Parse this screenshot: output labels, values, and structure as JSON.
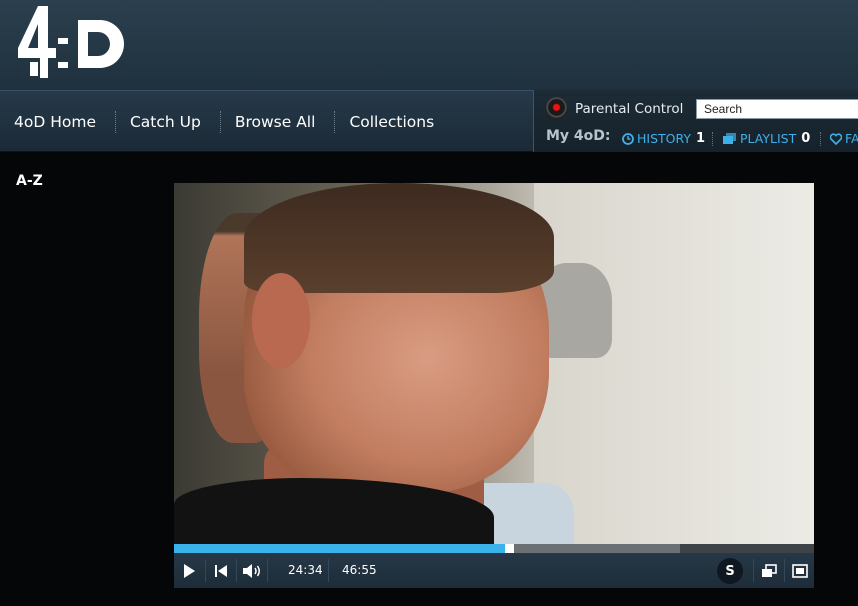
{
  "brand": {
    "logo_text": "4oD"
  },
  "nav": {
    "items": [
      {
        "label": "4oD Home"
      },
      {
        "label": "Catch Up"
      },
      {
        "label": "Browse All"
      },
      {
        "label": "Collections"
      }
    ]
  },
  "user_panel": {
    "parental_control_label": "Parental Control",
    "search_value": "Search",
    "my4od_label": "My 4oD:",
    "history_label": "HISTORY",
    "history_count": "1",
    "playlist_label": "PLAYLIST",
    "playlist_count": "0",
    "favourites_label": "FA"
  },
  "sidebar": {
    "az_label": "A-Z"
  },
  "player": {
    "current_time": "24:34",
    "duration": "46:55",
    "progress_fraction": 0.523,
    "buffered_fraction": 0.79,
    "subtitles_label": "S"
  },
  "colors": {
    "accent": "#3ab3ea",
    "header_bg": "#26394a",
    "link": "#3fb0e8"
  },
  "icons": {
    "play": "play-icon",
    "rewind": "skip-back-icon",
    "volume": "volume-icon",
    "popout": "popout-icon",
    "fullscreen": "fullscreen-icon",
    "history": "clock-icon",
    "playlist": "playlist-icon",
    "favourites": "heart-icon",
    "parental": "parental-control-icon"
  }
}
